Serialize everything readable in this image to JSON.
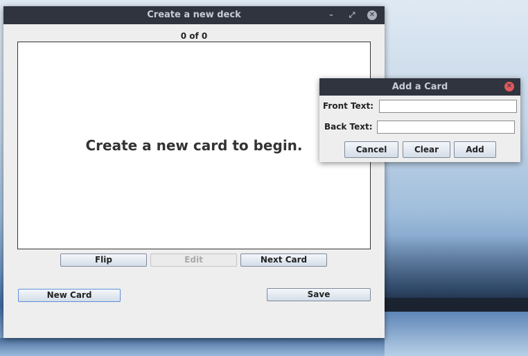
{
  "main_window": {
    "title": "Create a new deck",
    "counter": "0 of 0",
    "card_text": "Create a new card to begin.",
    "buttons": {
      "flip": "Flip",
      "edit": "Edit",
      "next_card": "Next Card",
      "new_card": "New Card",
      "save": "Save"
    },
    "controls": {
      "minimize": "–",
      "maximize": "⤢",
      "close": "✕"
    }
  },
  "dialog": {
    "title": "Add a Card",
    "front_label": "Front Text:",
    "front_value": "",
    "back_label": "Back Text:",
    "back_value": "",
    "buttons": {
      "cancel": "Cancel",
      "clear": "Clear",
      "add": "Add"
    },
    "close": "✕"
  },
  "colors": {
    "titlebar": "#2f343f",
    "close_accent": "#e3575a"
  }
}
